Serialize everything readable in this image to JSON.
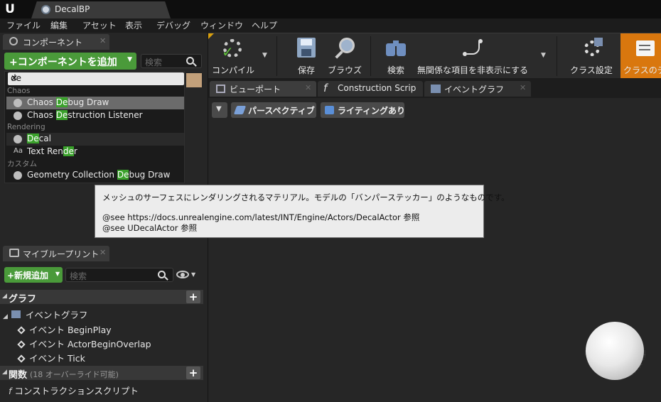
{
  "window": {
    "tab_title": "DecalBP"
  },
  "menu": {
    "items": [
      "ファイル",
      "編集",
      "アセット",
      "表示",
      "デバッグ",
      "ウィンドウ",
      "ヘルプ"
    ]
  },
  "components_panel": {
    "tab_label": "コンポーネント",
    "add_button": "+コンポーネントを追加",
    "search_placeholder": "検索",
    "filter_value": "de",
    "categories": {
      "chaos": "Chaos",
      "rendering": "Rendering",
      "custom": "カスタム"
    },
    "items": [
      {
        "pre": "Chaos ",
        "hl": "De",
        "post": "bug Draw"
      },
      {
        "pre": "Chaos ",
        "hl": "De",
        "post": "struction Listener"
      },
      {
        "pre": "",
        "hl": "De",
        "post": "cal"
      },
      {
        "pre": "Text Ren",
        "hl": "de",
        "post": "r"
      },
      {
        "pre": "Geometry Collection ",
        "hl": "De",
        "post": "bug Draw"
      }
    ],
    "text_render_icon": "Aa"
  },
  "tooltip": {
    "line1": "メッシュのサーフェスにレンダリングされるマテリアル。モデルの「バンパーステッカー」のようなものです。",
    "line2": "@see https://docs.unrealengine.com/latest/INT/Engine/Actors/DecalActor 参照",
    "line3": "@see UDecalActor 参照"
  },
  "my_blueprint": {
    "tab_label": "マイブループリント",
    "add_button": "+新規追加",
    "search_placeholder": "検索",
    "graph_header": "グラフ",
    "event_graph": "イベントグラフ",
    "events": [
      "イベント BeginPlay",
      "イベント ActorBeginOverlap",
      "イベント Tick"
    ],
    "functions_header": "関数",
    "functions_note": "(18 オーバーライド可能)",
    "construction_script": "コンストラクションスクリプト"
  },
  "toolbar": {
    "compile": "コンパイル",
    "save": "保存",
    "browse": "ブラウズ",
    "search": "検索",
    "hide_unrelated": "無関係な項目を非表示にする",
    "class_settings": "クラス設定",
    "class_defaults": "クラスのデ"
  },
  "editor_tabs": {
    "viewport": "ビューポート",
    "construction": "Construction Scrip",
    "event_graph": "イベントグラフ"
  },
  "viewport": {
    "perspective": "パースペクティブ",
    "lighting": "ライティングあり"
  },
  "colors": {
    "accent_green": "#4a9a3a",
    "highlight_green": "#3aa12b",
    "class_defaults_orange": "#d9770e"
  }
}
